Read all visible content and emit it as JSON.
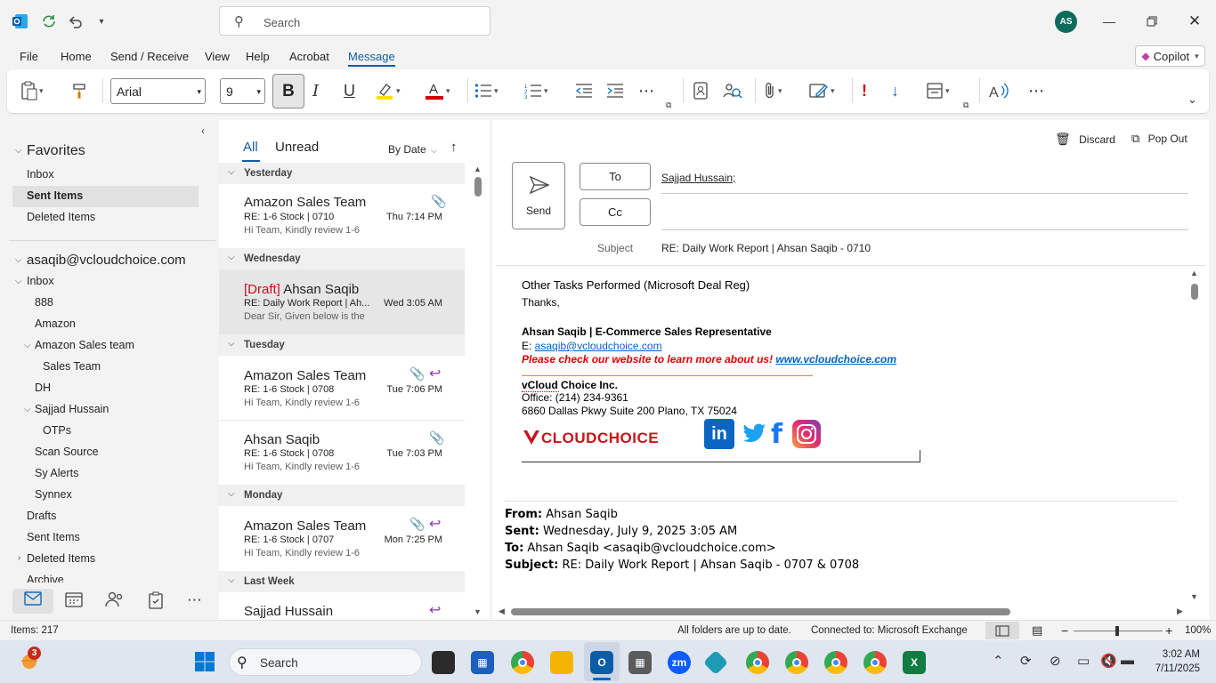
{
  "app": {
    "search_placeholder": "Search",
    "avatar_initials": "AS"
  },
  "menu": {
    "items": [
      "File",
      "Home",
      "Send / Receive",
      "View",
      "Help",
      "Acrobat",
      "Message"
    ],
    "active": "Message",
    "copilot": "Copilot"
  },
  "ribbon": {
    "font_name": "Arial",
    "font_size": "9",
    "bold": "B",
    "italic": "I",
    "underline": "U"
  },
  "nav": {
    "favorites_label": "Favorites",
    "favorites": [
      "Inbox",
      "Sent Items",
      "Deleted Items"
    ],
    "account": "asaqib@vcloudchoice.com",
    "inbox": "Inbox",
    "folders": {
      "f888": "888",
      "amazon": "Amazon",
      "amazon_sales_team": "Amazon Sales team",
      "sales_team": "Sales Team",
      "dh": "DH",
      "sajjad": "Sajjad Hussain",
      "otps": "OTPs",
      "scan_source": "Scan Source",
      "sy_alerts": "Sy Alerts",
      "synnex": "Synnex",
      "drafts": "Drafts",
      "sent_items": "Sent Items",
      "deleted_items": "Deleted Items",
      "archive": "Archive"
    }
  },
  "list": {
    "tab_all": "All",
    "tab_unread": "Unread",
    "sort": "By Date",
    "groups": {
      "yesterday": "Yesterday",
      "wednesday": "Wednesday",
      "tuesday": "Tuesday",
      "monday": "Monday",
      "last_week": "Last Week"
    },
    "messages": [
      {
        "sender": "Amazon Sales Team",
        "subject": "RE: 1-6 Stock | 0710",
        "time": "Thu 7:14 PM",
        "preview": "Hi Team,  Kindly review 1-6"
      },
      {
        "draft": "[Draft]",
        "sender": "Ahsan Saqib",
        "subject": "RE: Daily Work Report | Ah...",
        "time": "Wed 3:05 AM",
        "preview": "Dear Sir,  Given below is the"
      },
      {
        "sender": "Amazon Sales Team",
        "subject": "RE: 1-6 Stock | 0708",
        "time": "Tue 7:06 PM",
        "preview": "Hi Team,  Kindly review 1-6"
      },
      {
        "sender": "Ahsan Saqib",
        "subject": "RE: 1-6 Stock | 0708",
        "time": "Tue 7:03 PM",
        "preview": "Hi Team,  Kindly review 1-6"
      },
      {
        "sender": "Amazon Sales Team",
        "subject": "RE: 1-6 Stock | 0707",
        "time": "Mon 7:25 PM",
        "preview": "Hi Team,  Kindly review 1-6"
      },
      {
        "sender": "Sajjad Hussain"
      }
    ]
  },
  "compose": {
    "discard": "Discard",
    "pop_out": "Pop Out",
    "send": "Send",
    "to_btn": "To",
    "cc_btn": "Cc",
    "to_value": "Sajjad Hussain;",
    "subject_label": "Subject",
    "subject_value": "RE: Daily Work Report | Ahsan Saqib - 0710"
  },
  "body": {
    "line1": "Other Tasks Performed (Microsoft Deal Reg)",
    "thanks": "Thanks,",
    "sig_name": "Ahsan Saqib | E-Commerce Sales Representative",
    "email_label": "E: ",
    "email": "asaqib@vcloudchoice.com",
    "website_prompt": "Please check our website to learn more about us! ",
    "website": "www.vcloudchoice.com",
    "company": "vCloud Choice Inc.",
    "office": "Office: (214) 234-9361",
    "address": "6860 Dallas Pkwy Suite 200 Plano, TX 75024",
    "logo_text": "CLOUDCHOICE",
    "from_label": "From:",
    "from_value": " Ahsan Saqib",
    "sent_label": "Sent:",
    "sent_value": " Wednesday, July 9, 2025 3:05 AM",
    "to_label": "To:",
    "to_value": " Ahsan Saqib <asaqib@vcloudchoice.com>",
    "subject_label": "Subject:",
    "subject_value": " RE: Daily Work Report | Ahsan Saqib - 0707 & 0708"
  },
  "status": {
    "items": "Items: 217",
    "sync": "All folders are up to date.",
    "connection": "Connected to: Microsoft Exchange",
    "zoom": "100%"
  },
  "taskbar": {
    "search": "Search",
    "badge": "3",
    "time": "3:02 AM",
    "date": "7/11/2025"
  },
  "colors": {
    "accent": "#115ea3",
    "draft_red": "#c50f1f",
    "avatar_bg": "#0f6b5c"
  }
}
